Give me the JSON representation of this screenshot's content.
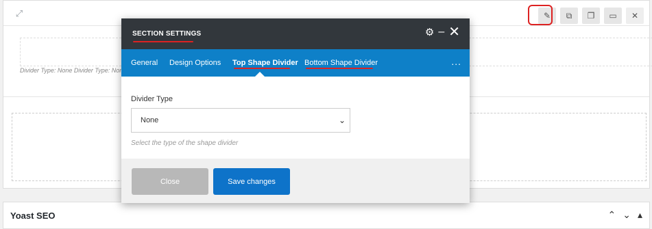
{
  "builder": {
    "divider_note": "Divider Type: None  Divider Type: None",
    "controls": [
      "edit-icon",
      "duplicate-icon",
      "copy-icon",
      "paste-icon",
      "close-icon"
    ]
  },
  "modal": {
    "title": "SECTION SETTINGS",
    "tabs": [
      "General",
      "Design Options",
      "Top Shape Divider",
      "Bottom Shape Divider"
    ],
    "more": "...",
    "field": {
      "label": "Divider Type",
      "value": "None",
      "hint": "Select the type of the shape divider"
    },
    "buttons": {
      "close": "Close",
      "save": "Save changes"
    }
  },
  "yoast": {
    "title": "Yoast SEO"
  },
  "colors": {
    "header": "#32373c",
    "tabs": "#0e80c8",
    "save": "#0e73c9",
    "annotation": "#dd2222"
  }
}
